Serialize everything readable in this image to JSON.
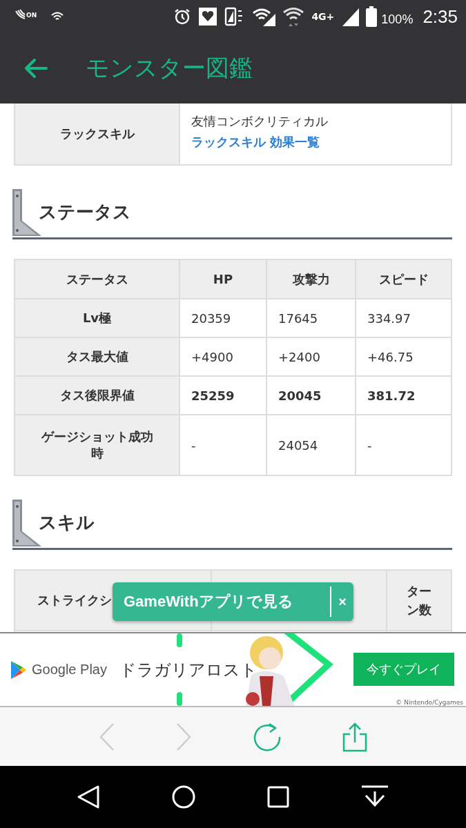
{
  "status_bar": {
    "nfc_label": "ON",
    "network_label": "4G+",
    "battery": "100%",
    "time": "2:35"
  },
  "app_bar": {
    "title": "モンスター図鑑"
  },
  "luck_skill": {
    "label": "ラックスキル",
    "value": "友情コンボクリティカル",
    "link": "ラックスキル 効果一覧"
  },
  "status_section": {
    "heading": "ステータス",
    "columns": [
      "ステータス",
      "HP",
      "攻撃力",
      "スピード"
    ],
    "rows": [
      {
        "cells": [
          "Lv極",
          "20359",
          "17645",
          "334.97"
        ],
        "bold": false
      },
      {
        "cells": [
          "タス最大値",
          "+4900",
          "+2400",
          "+46.75"
        ],
        "bold": false
      },
      {
        "cells": [
          "タス後限界値",
          "25259",
          "20045",
          "381.72"
        ],
        "bold": true
      },
      {
        "cells": [
          "ゲージショット成功時",
          "-",
          "24054",
          "-"
        ],
        "bold": false
      }
    ]
  },
  "skill_section": {
    "heading": "スキル",
    "columns": [
      "ストライクシ",
      "ターン数"
    ]
  },
  "app_banner": {
    "label": "GameWithアプリで見る",
    "close": "×"
  },
  "ad": {
    "store": "Google Play",
    "title": "ドラガリアロスト",
    "button": "今すぐプレイ",
    "credit": "© Nintendo/Cygames"
  },
  "browser_toolbar": {
    "back_disabled": true,
    "forward_disabled": true
  }
}
